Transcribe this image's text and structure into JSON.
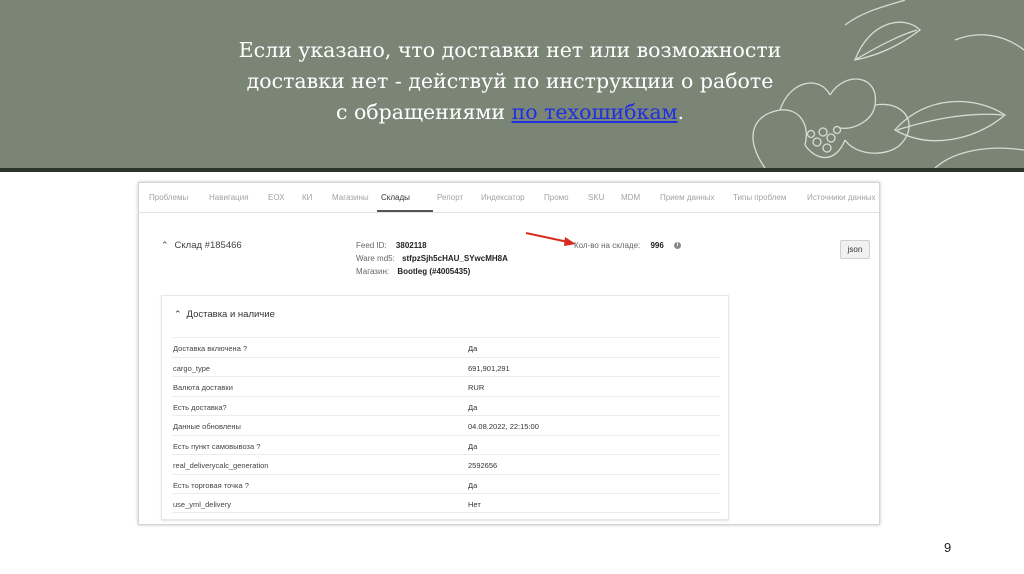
{
  "slide": {
    "headline": {
      "line1": "Если указано, что доставки нет или возможности",
      "line2": "доставки нет - действуй по инструкции о работе",
      "line3_prefix": "с обращениями ",
      "link_text": "по техошибкам",
      "line3_suffix": "."
    },
    "page_number": "9"
  },
  "screenshot": {
    "tabs": [
      {
        "label": "Проблемы",
        "active": false
      },
      {
        "label": "Навигация",
        "active": false
      },
      {
        "label": "ЕОХ",
        "active": false
      },
      {
        "label": "КИ",
        "active": false
      },
      {
        "label": "Магазины",
        "active": false
      },
      {
        "label": "Склады",
        "active": true
      },
      {
        "label": "Репорт",
        "active": false
      },
      {
        "label": "Индексатор",
        "active": false
      },
      {
        "label": "Промо",
        "active": false
      },
      {
        "label": "SKU",
        "active": false
      },
      {
        "label": "MDM",
        "active": false
      },
      {
        "label": "Прием данных",
        "active": false
      },
      {
        "label": "Типы проблем",
        "active": false
      },
      {
        "label": "Источники данных",
        "active": false
      }
    ],
    "warehouse_title": "Склад #185466",
    "meta": {
      "feed_id_label": "Feed ID:",
      "feed_id_value": "3802118",
      "ware_md5_label": "Ware md5:",
      "ware_md5_value": "stfpzSjh5cHAU_SYwcMH8A",
      "shop_label": "Магазин:",
      "shop_value": "Bootleg (#4005435)",
      "stock_label": "Кол-во на складе:",
      "stock_value": "996",
      "info_icon": "info-icon"
    },
    "json_button": "json",
    "annotation_arrow_color": "#d92b20",
    "panel": {
      "title": "Доставка и наличие",
      "rows": [
        {
          "key": "Доставка включена ?",
          "value": "Да"
        },
        {
          "key": "cargo_type",
          "value": "691,901,291"
        },
        {
          "key": "Валюта доставки",
          "value": "RUR"
        },
        {
          "key": "Есть доставка?",
          "value": "Да"
        },
        {
          "key": "Данные обновлены",
          "value": "04.08.2022, 22:15:00"
        },
        {
          "key": "Есть пункт самовывоза ?",
          "value": "Да"
        },
        {
          "key": "real_deliverycalc_generation",
          "value": "2592656"
        },
        {
          "key": "Есть торговая точка ?",
          "value": "Да"
        },
        {
          "key": "use_yml_delivery",
          "value": "Нет"
        }
      ]
    }
  },
  "colors": {
    "banner_bg": "#7b8576",
    "banner_rule": "#2f352d",
    "link": "#1f2fe0"
  }
}
